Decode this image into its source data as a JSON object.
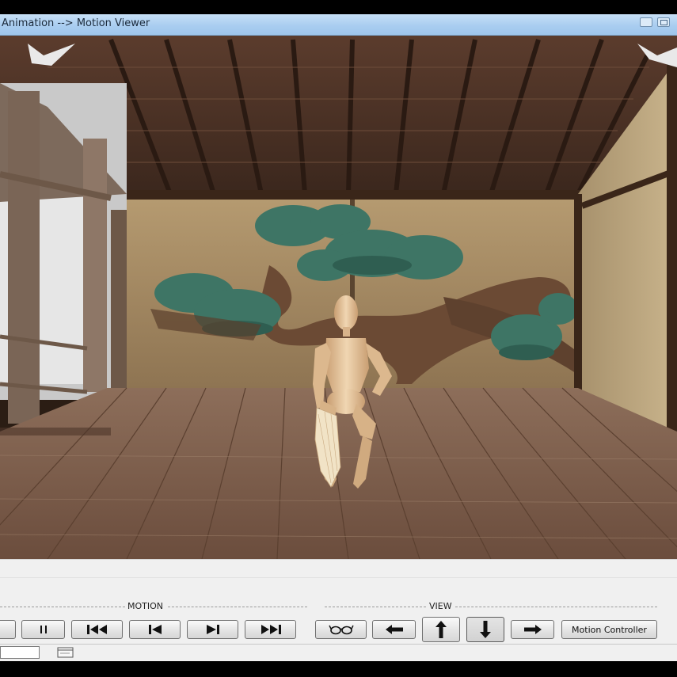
{
  "window": {
    "title": "Animation --> Motion Viewer"
  },
  "viewport": {
    "scene": "3d-stage-viewport"
  },
  "controls": {
    "motion_label": "MOTION",
    "view_label": "VIEW",
    "motion_controller_label": "Motion Controller"
  },
  "icons": {
    "pause": "pause-icon",
    "first": "skip-to-start-icon",
    "prev": "step-back-icon",
    "next": "step-forward-icon",
    "last": "skip-to-end-icon",
    "glasses": "glasses-icon",
    "left": "arrow-left-icon",
    "up": "arrow-up-icon",
    "down": "arrow-down-icon",
    "right": "arrow-right-icon"
  },
  "colors": {
    "titlebar": "#a9cdf0",
    "panel": "#f0f0f0",
    "floor": "#7a5c48",
    "ceiling": "#4a3024",
    "pine": "#3e7565",
    "figure": "#e8c9a2"
  }
}
